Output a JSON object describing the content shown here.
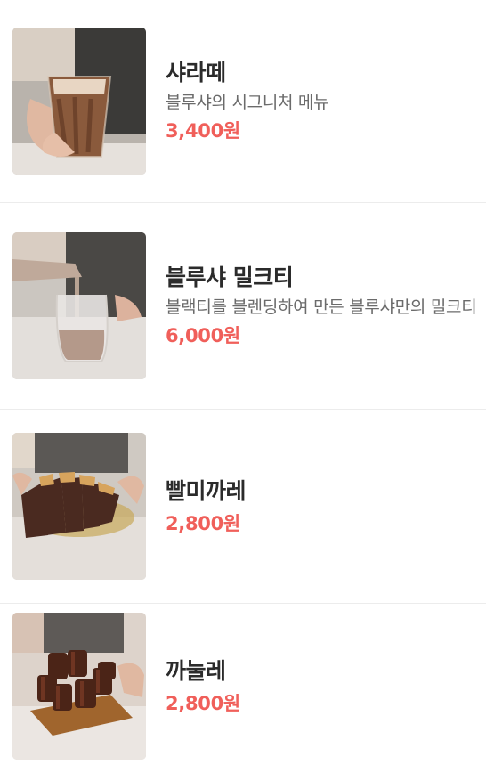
{
  "menu": {
    "items": [
      {
        "name": "샤라떼",
        "description": "블루샤의 시그니처 메뉴",
        "price": "3,400원",
        "image_icon": "latte-glass-photo"
      },
      {
        "name": "블루샤 밀크티",
        "description": "블랙티를 블렌딩하여 만든 블루샤만의 밀크티",
        "price": "6,000원",
        "image_icon": "milk-tea-pour-photo"
      },
      {
        "name": "빨미까레",
        "description": "",
        "price": "2,800원",
        "image_icon": "palmier-plate-photo"
      },
      {
        "name": "까눌레",
        "description": "",
        "price": "2,800원",
        "image_icon": "canele-board-photo"
      }
    ]
  },
  "colors": {
    "price": "#f05f5a",
    "name": "#2b2b2b",
    "description": "#6b6b6b",
    "divider": "#ececec"
  }
}
